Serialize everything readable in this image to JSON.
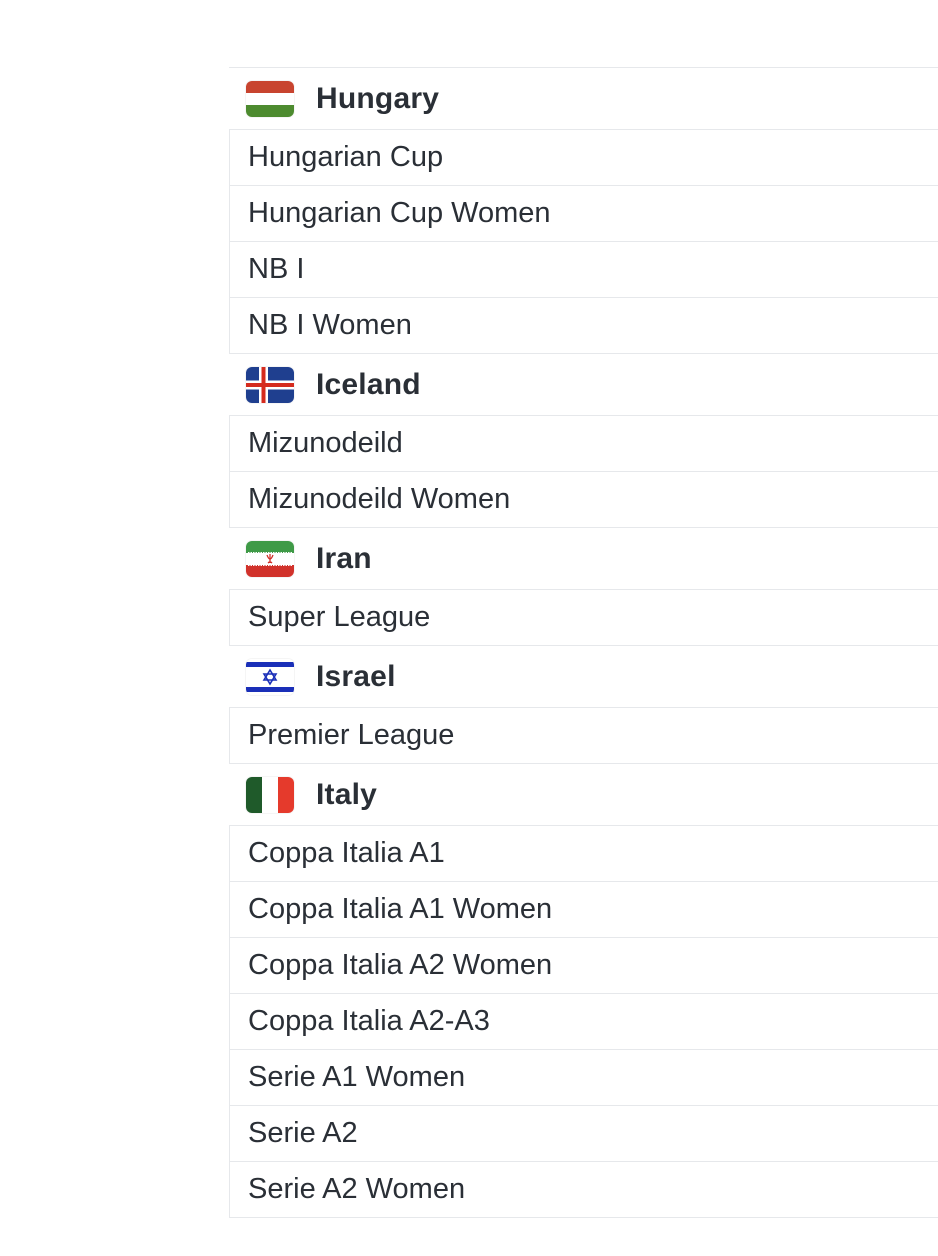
{
  "countries": [
    {
      "name": "Hungary",
      "flag_icon": "hungary-flag-icon",
      "leagues": [
        "Hungarian Cup",
        "Hungarian Cup Women",
        "NB I",
        "NB I Women"
      ]
    },
    {
      "name": "Iceland",
      "flag_icon": "iceland-flag-icon",
      "leagues": [
        "Mizunodeild",
        "Mizunodeild Women"
      ]
    },
    {
      "name": "Iran",
      "flag_icon": "iran-flag-icon",
      "leagues": [
        "Super League"
      ]
    },
    {
      "name": "Israel",
      "flag_icon": "israel-flag-icon",
      "leagues": [
        "Premier League"
      ]
    },
    {
      "name": "Italy",
      "flag_icon": "italy-flag-icon",
      "leagues": [
        "Coppa Italia A1",
        "Coppa Italia A1 Women",
        "Coppa Italia A2 Women",
        "Coppa Italia A2-A3",
        "Serie A1 Women",
        "Serie A2",
        "Serie A2 Women"
      ]
    }
  ],
  "colors": {
    "text": "#2a2f36",
    "divider": "#e6e8eb",
    "hungary": [
      "#c8442f",
      "#ffffff",
      "#4d8b2f"
    ],
    "iceland": [
      "#1f3f8f",
      "#ffffff",
      "#d52b1e"
    ],
    "iran": [
      "#3f9a47",
      "#ffffff",
      "#d1322b"
    ],
    "israel": [
      "#1a2fb8",
      "#ffffff"
    ],
    "italy": [
      "#1f5a2a",
      "#ffffff",
      "#e53a2c"
    ]
  }
}
